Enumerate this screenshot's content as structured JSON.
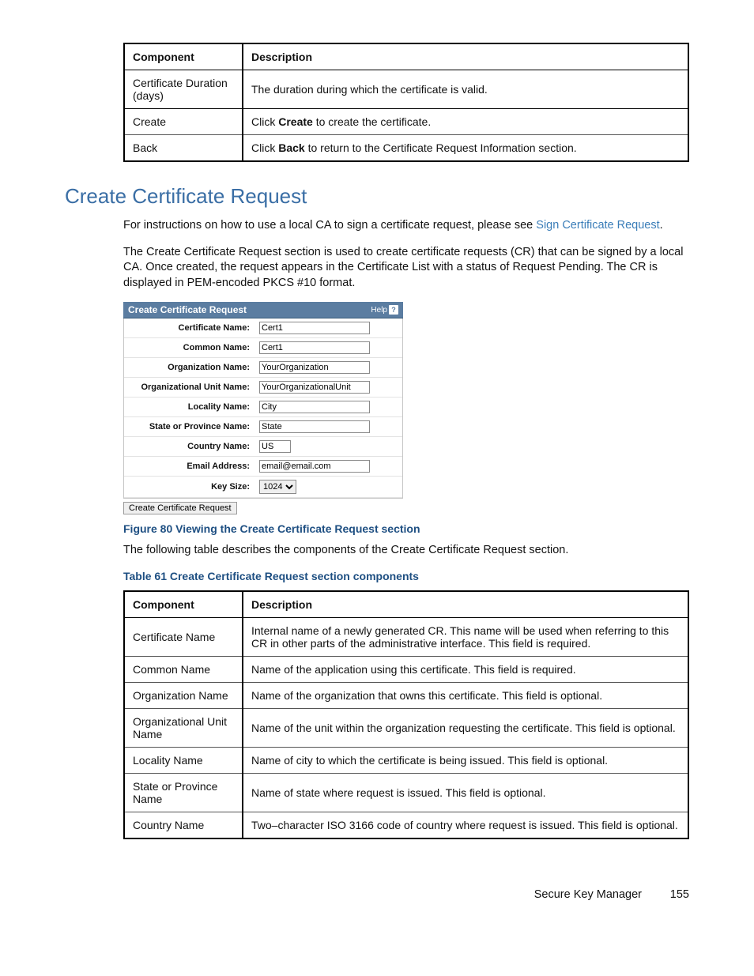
{
  "table_top": {
    "headers": [
      "Component",
      "Description"
    ],
    "rows": [
      {
        "comp": "Certificate Duration (days)",
        "desc_plain": "The duration during which the certificate is valid."
      },
      {
        "comp": "Create",
        "desc_pre": "Click ",
        "desc_bold": "Create",
        "desc_post": " to create the certificate."
      },
      {
        "comp": "Back",
        "desc_pre": "Click ",
        "desc_bold": "Back",
        "desc_post": " to return to the Certificate Request Information section."
      }
    ]
  },
  "section_title": "Create Certificate Request",
  "para1_pre": "For instructions on how to use a local CA to sign a certificate request, please see ",
  "para1_link": "Sign Certificate Request",
  "para1_post": ".",
  "para2": "The Create Certificate Request section is used to create certificate requests (CR) that can be signed by a local CA. Once created, the request appears in the Certificate List with a status of Request Pending. The CR is displayed in PEM-encoded PKCS #10 format.",
  "form": {
    "title": "Create Certificate Request",
    "help": "Help",
    "fields": {
      "cert_name": {
        "label": "Certificate Name:",
        "value": "Cert1"
      },
      "common_name": {
        "label": "Common Name:",
        "value": "Cert1"
      },
      "org_name": {
        "label": "Organization Name:",
        "value": "YourOrganization"
      },
      "ou_name": {
        "label": "Organizational Unit Name:",
        "value": "YourOrganizationalUnit"
      },
      "locality": {
        "label": "Locality Name:",
        "value": "City"
      },
      "state": {
        "label": "State or Province Name:",
        "value": "State"
      },
      "country": {
        "label": "Country Name:",
        "value": "US"
      },
      "email": {
        "label": "Email Address:",
        "value": "email@email.com"
      },
      "key_size": {
        "label": "Key Size:",
        "value": "1024"
      }
    },
    "button": "Create Certificate Request"
  },
  "figure_caption": "Figure 80 Viewing the Create Certificate Request section",
  "para3": "The following table describes the components of the Create Certificate Request section.",
  "table_caption": "Table 61 Create Certificate Request section components",
  "table_main": {
    "headers": [
      "Component",
      "Description"
    ],
    "rows": [
      {
        "comp": "Certificate Name",
        "desc": "Internal name of a newly generated CR. This name will be used when referring to this CR in other parts of the administrative interface. This field is required."
      },
      {
        "comp": "Common Name",
        "desc": "Name of the application using this certificate. This field is required."
      },
      {
        "comp": "Organization Name",
        "desc": "Name of the organization that owns this certificate. This field is optional."
      },
      {
        "comp": "Organizational Unit Name",
        "desc": "Name of the unit within the organization requesting the certificate. This field is optional."
      },
      {
        "comp": "Locality Name",
        "desc": "Name of city to which the certificate is being issued. This field is optional."
      },
      {
        "comp": "State or Province Name",
        "desc": "Name of state where request is issued. This field is optional."
      },
      {
        "comp": "Country Name",
        "desc": "Two–character ISO 3166 code of country where request is issued. This field is optional."
      }
    ]
  },
  "footer": {
    "title": "Secure Key Manager",
    "page": "155"
  },
  "chart_data": {
    "type": "table",
    "tables": [
      {
        "title": "Top table (continued)",
        "columns": [
          "Component",
          "Description"
        ],
        "rows": [
          [
            "Certificate Duration (days)",
            "The duration during which the certificate is valid."
          ],
          [
            "Create",
            "Click Create to create the certificate."
          ],
          [
            "Back",
            "Click Back to return to the Certificate Request Information section."
          ]
        ]
      },
      {
        "title": "Table 61 Create Certificate Request section components",
        "columns": [
          "Component",
          "Description"
        ],
        "rows": [
          [
            "Certificate Name",
            "Internal name of a newly generated CR. This name will be used when referring to this CR in other parts of the administrative interface. This field is required."
          ],
          [
            "Common Name",
            "Name of the application using this certificate. This field is required."
          ],
          [
            "Organization Name",
            "Name of the organization that owns this certificate. This field is optional."
          ],
          [
            "Organizational Unit Name",
            "Name of the unit within the organization requesting the certificate. This field is optional."
          ],
          [
            "Locality Name",
            "Name of city to which the certificate is being issued. This field is optional."
          ],
          [
            "State or Province Name",
            "Name of state where request is issued. This field is optional."
          ],
          [
            "Country Name",
            "Two–character ISO 3166 code of country where request is issued. This field is optional."
          ]
        ]
      }
    ],
    "form": {
      "title": "Create Certificate Request",
      "fields": {
        "Certificate Name": "Cert1",
        "Common Name": "Cert1",
        "Organization Name": "YourOrganization",
        "Organizational Unit Name": "YourOrganizationalUnit",
        "Locality Name": "City",
        "State or Province Name": "State",
        "Country Name": "US",
        "Email Address": "email@email.com",
        "Key Size": "1024"
      }
    }
  }
}
